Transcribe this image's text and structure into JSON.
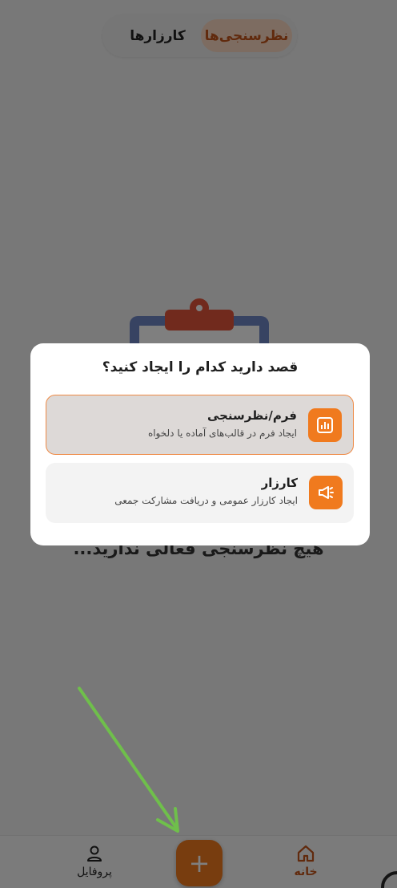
{
  "tabs": [
    {
      "label": "نظرسنجی‌ها",
      "active": true
    },
    {
      "label": "کارزارها",
      "active": false
    }
  ],
  "empty_state": {
    "message": "هیچ نظرسنجی فعالی ندارید..."
  },
  "dialog": {
    "title": "قصد دارید کدام را ایجاد کنید؟",
    "options": [
      {
        "title": "فرم/نظرسنجی",
        "description": "ایجاد فرم در قالب‌های آماده یا دلخواه",
        "icon": "chart-icon",
        "selected": true
      },
      {
        "title": "کارزار",
        "description": "ایجاد کارزار عمومی و دریافت مشارکت جمعی",
        "icon": "megaphone-icon",
        "selected": false
      }
    ]
  },
  "bottom_nav": {
    "home_label": "خانه",
    "add_label": "+",
    "profile_label": "پروفایل"
  },
  "colors": {
    "accent": "#f07a1e",
    "accent_text": "#c2551b",
    "annotation_arrow": "#6fbf4b"
  }
}
